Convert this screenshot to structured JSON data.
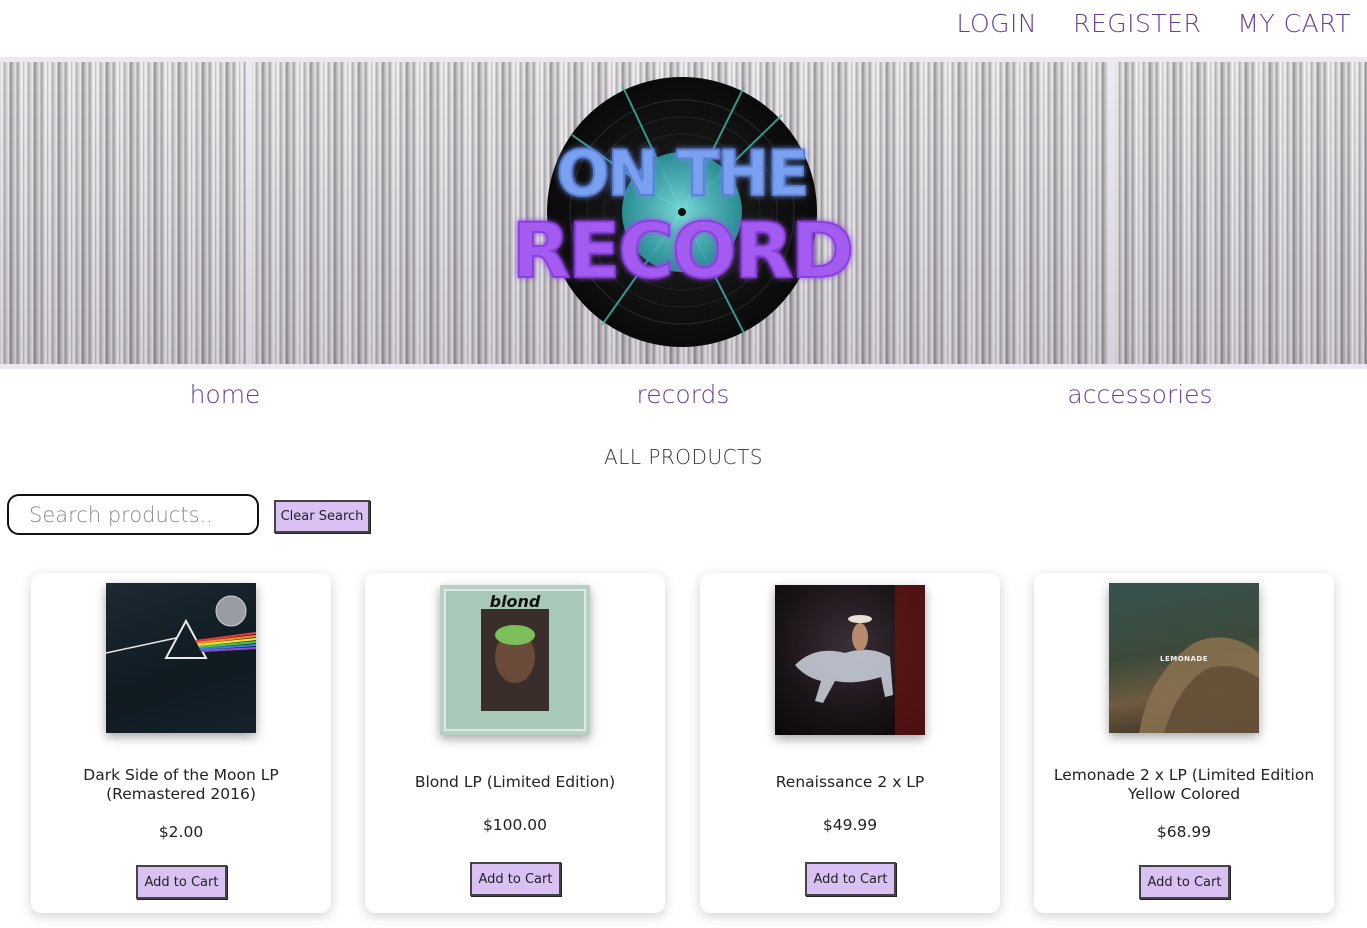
{
  "header": {
    "login": "LOGIN",
    "register": "REGISTER",
    "cart": "MY CART"
  },
  "banner": {
    "logo_line1": "ON THE",
    "logo_line2": "RECORD"
  },
  "nav": {
    "items": [
      "home",
      "records",
      "accessories"
    ]
  },
  "section_title": "ALL PRODUCTS",
  "search": {
    "placeholder": "Search products..",
    "value": "",
    "clear_label": "Clear Search"
  },
  "products": [
    {
      "title_line1": "Dark Side of the Moon LP",
      "title_line2": "(Remastered 2016)",
      "price": "$2.00",
      "add_label": "Add to Cart",
      "cover_icon": "prism-album-cover"
    },
    {
      "title_line1": "Blond LP (Limited Edition)",
      "title_line2": "",
      "price": "$100.00",
      "add_label": "Add to Cart",
      "cover_icon": "blond-album-cover",
      "cover_text": "blond"
    },
    {
      "title_line1": "Renaissance 2 x LP",
      "title_line2": "",
      "price": "$49.99",
      "add_label": "Add to Cart",
      "cover_icon": "horse-album-cover"
    },
    {
      "title_line1": "Lemonade 2 x LP (Limited Edition",
      "title_line2": "Yellow Colored",
      "price": "$68.99",
      "add_label": "Add to Cart",
      "cover_icon": "lemonade-album-cover",
      "cover_text": "LEMONADE"
    }
  ],
  "colors": {
    "accent_text": "#6a3d9a",
    "button_bg": "#d9c2f3",
    "logo_blue": "#7aa0f0",
    "logo_purple": "#a45cf0"
  }
}
